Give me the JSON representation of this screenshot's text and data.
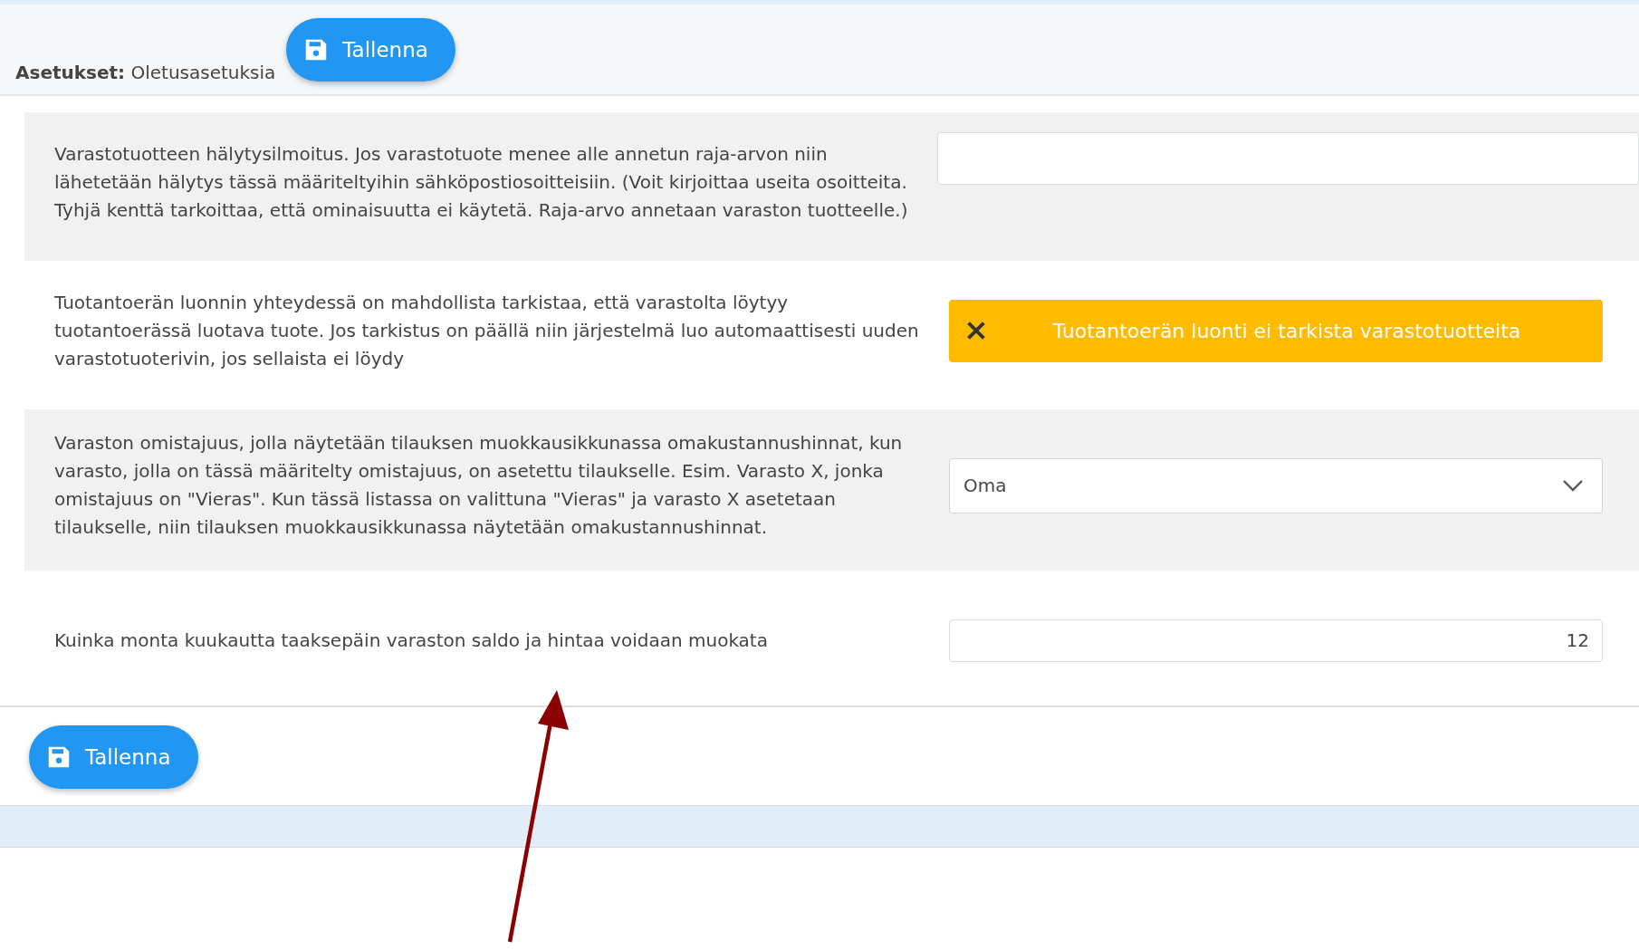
{
  "header": {
    "label": "Asetukset:",
    "value": "Oletusasetuksia",
    "save_button": "Tallenna"
  },
  "settings": [
    {
      "kind": "text",
      "description": "Varastotuotteen hälytysilmoitus. Jos varastotuote menee alle annetun raja-arvon niin lähetetään hälytys tässä määriteltyihin sähköpostiosoitteisiin. (Voit kirjoittaa useita osoitteita. Tyhjä kenttä tarkoittaa, että ominaisuutta ei käytetä. Raja-arvo annetaan varaston tuotteelle.)"
    },
    {
      "kind": "toggle",
      "description": "Tuotantoerän luonnin yhteydessä on mahdollista tarkistaa, että varastolta löytyy tuotantoerässä luotava tuote. Jos tarkistus on päällä niin järjestelmä luo automaattisesti uuden varastotuoterivin, jos sellaista ei löydy",
      "label": "Tuotantoerän luonti ei tarkista varastotuotteita",
      "on": false
    },
    {
      "kind": "select",
      "description": "Varaston omistajuus, jolla näytetään tilauksen muokkausikkunassa omakustannushinnat, kun varasto, jolla on tässä määritelty omistajuus, on asetettu tilaukselle. Esim. Varasto X, jonka omistajuus on \"Vieras\". Kun tässä listassa on valittuna \"Vieras\" ja varasto X asetetaan tilaukselle, niin tilauksen muokkausikkunassa näytetään omakustannushinnat.",
      "value": "Oma"
    },
    {
      "kind": "number",
      "description": "Kuinka monta kuukautta taaksepäin varaston saldo ja hintaa voidaan muokata",
      "value": "12"
    }
  ],
  "footer": {
    "save_button": "Tallenna"
  }
}
